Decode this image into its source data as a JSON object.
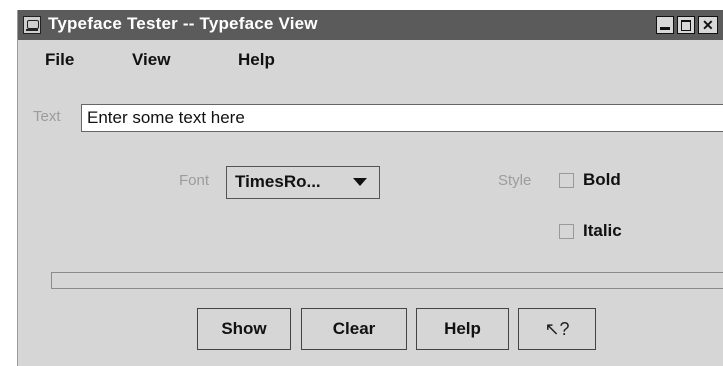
{
  "window": {
    "title": "Typeface Tester -- Typeface View",
    "icon": "app-icon"
  },
  "menu": {
    "file": "File",
    "view": "View",
    "help": "Help"
  },
  "form": {
    "text_label": "Text",
    "text_value": "Enter some text here",
    "font_label": "Font",
    "font_value": "TimesRo...",
    "style_label": "Style",
    "bold_label": "Bold",
    "italic_label": "Italic",
    "bold_checked": false,
    "italic_checked": false
  },
  "buttons": {
    "show": "Show",
    "clear": "Clear",
    "help": "Help",
    "context_help_icon": "context-help-pointer-icon",
    "context_help_glyph": "↖?"
  },
  "colors": {
    "titlebar": "#5b5b5b",
    "window_bg": "#d6d6d6",
    "label_gray": "#9c9c9c"
  }
}
